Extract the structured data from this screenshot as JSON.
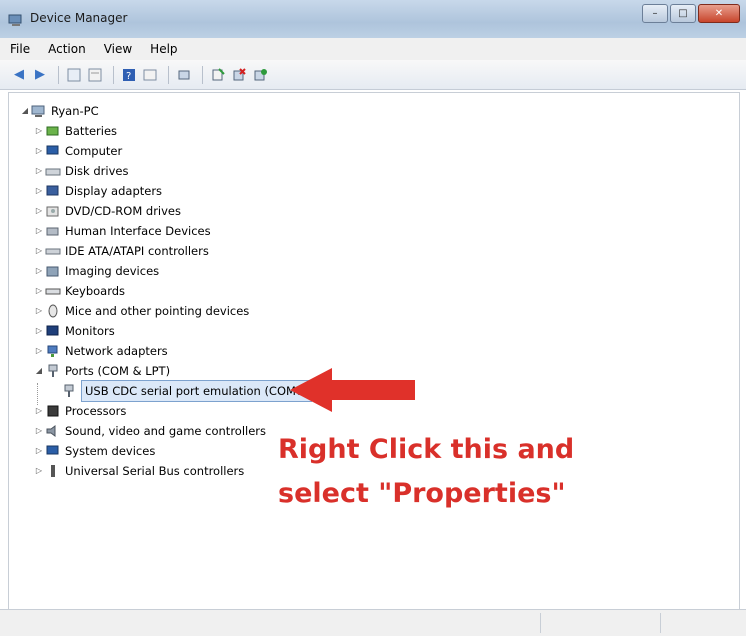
{
  "window": {
    "title": "Device Manager"
  },
  "menu": [
    "File",
    "Action",
    "View",
    "Help"
  ],
  "toolbar": [
    "back-icon",
    "forward-icon",
    "properties-icon",
    "update-icon",
    "help-icon",
    "view-icon",
    "scan-icon",
    "update-driver-icon",
    "uninstall-icon",
    "disable-icon"
  ],
  "tree": {
    "root": "Ryan-PC",
    "items": [
      "Batteries",
      "Computer",
      "Disk drives",
      "Display adapters",
      "DVD/CD-ROM drives",
      "Human Interface Devices",
      "IDE ATA/ATAPI controllers",
      "Imaging devices",
      "Keyboards",
      "Mice and other pointing devices",
      "Monitors",
      "Network adapters",
      "Ports (COM & LPT)",
      "USB CDC serial port emulation (COM6)",
      "Processors",
      "Sound, video and game controllers",
      "System devices",
      "Universal Serial Bus controllers"
    ]
  },
  "annotation": {
    "line1": "Right Click this and",
    "line2": "select \"Properties\"",
    "color": "#d9302a"
  }
}
